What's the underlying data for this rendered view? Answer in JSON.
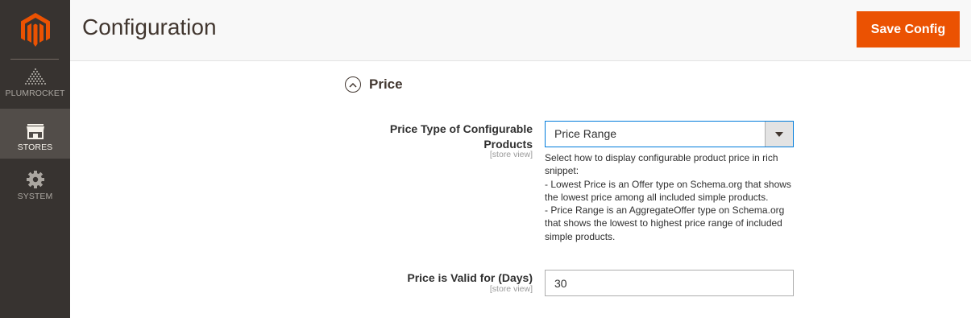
{
  "sidebar": {
    "items": [
      {
        "label": "PLUMROCKET",
        "icon": "plumrocket-icon"
      },
      {
        "label": "STORES",
        "icon": "store-icon",
        "active": true
      },
      {
        "label": "SYSTEM",
        "icon": "gear-icon"
      }
    ]
  },
  "header": {
    "title": "Configuration",
    "save_label": "Save Config"
  },
  "section": {
    "title": "Price",
    "icon": "chevron-up-circle-icon"
  },
  "fields": {
    "price_type": {
      "label": "Price Type of Configurable Products",
      "scope": "[store view]",
      "value": "Price Range",
      "note_lines": [
        "Select how to display configurable product price in rich snippet:",
        "- Lowest Price is an Offer type on Schema.org that shows the lowest price among all included simple products.",
        "- Price Range is an AggregateOffer type on Schema.org that shows the lowest to highest price range of included simple products."
      ]
    },
    "valid_days": {
      "label": "Price is Valid for (Days)",
      "scope": "[store view]",
      "value": "30"
    }
  },
  "colors": {
    "sidebar_bg": "#373330",
    "sidebar_active": "#524d49",
    "brand_orange": "#eb5202",
    "focus_blue": "#007bdb"
  }
}
